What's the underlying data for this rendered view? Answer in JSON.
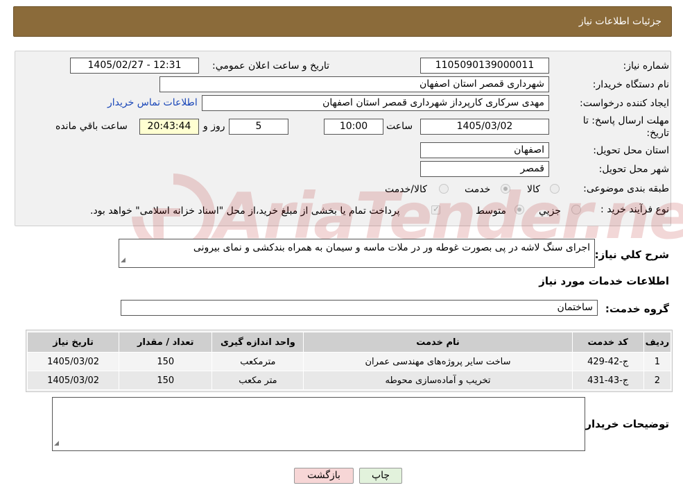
{
  "header": {
    "title": "جزئیات اطلاعات نیاز"
  },
  "form": {
    "need_number": {
      "label": "شماره نیاز:",
      "value": "1105090139000011"
    },
    "announce_datetime": {
      "label": "تاریخ و ساعت اعلان عمومي:",
      "value": "1405/02/27 - 12:31"
    },
    "buyer_org": {
      "label": "نام دستگاه خريدار:",
      "value": "شهرداری قمصر استان اصفهان"
    },
    "requester": {
      "label": "ايجاد کننده درخواست:",
      "value": "مهدی سرکاری کارپرداز شهرداری قمصر استان اصفهان",
      "contact_link": "اطلاعات تماس خريدار"
    },
    "deadline": {
      "label_line1": "مهلت ارسال پاسخ: تا",
      "label_line2": "تاريخ:",
      "date": "1405/03/02",
      "time_label": "ساعت",
      "time": "10:00",
      "days": "5",
      "days_label": "روز و",
      "remaining": "20:43:44",
      "remaining_label": "ساعت باقي مانده"
    },
    "delivery_province": {
      "label": "استان محل تحويل:",
      "value": "اصفهان"
    },
    "delivery_city": {
      "label": "شهر محل تحويل:",
      "value": "قمصر"
    },
    "category": {
      "label": "طبقه بندی موضوعی:",
      "options": [
        "كالا",
        "خدمت",
        "كالا/خدمت"
      ],
      "selected": "خدمت"
    },
    "purchase_type": {
      "label": "نوع فرآيند خريد :",
      "options": [
        "جزيي",
        "متوسط"
      ],
      "selected": "متوسط",
      "payment_note": "پرداخت تمام يا بخشی از مبلغ خريد،از محل \"اسناد خزانه اسلامی\" خواهد بود."
    }
  },
  "description": {
    "label": "شرح كلي نياز:",
    "value": "اجرای سنگ لاشه در پی بصورت غوطه ور در ملات ماسه و سیمان  به همراه بندکشی و نمای بیرونی"
  },
  "services": {
    "section_title": "اطلاعات خدمات مورد نياز",
    "group_label": "گروه خدمت:",
    "group_value": "ساختمان",
    "columns": [
      "رديف",
      "كد خدمت",
      "نام خدمت",
      "واحد اندازه گيری",
      "تعداد / مقدار",
      "تاريخ نياز"
    ],
    "rows": [
      [
        "1",
        "ج-42-429",
        "ساخت ساير پروژه‌های مهندسی عمران",
        "مترمکعب",
        "150",
        "1405/03/02"
      ],
      [
        "2",
        "ج-43-431",
        "تخريب و آماده‌سازی محوطه",
        "متر مكعب",
        "150",
        "1405/03/02"
      ]
    ]
  },
  "buyer_notes": {
    "label": "توضيحات خريدار:",
    "value": ""
  },
  "buttons": {
    "print": "چاپ",
    "back": "بازگشت"
  },
  "watermark": {
    "text": "AriaTender.neT"
  },
  "colors": {
    "header_bg": "#8b6b3a",
    "link": "#1a47b8",
    "back_button": "#f7d6d6",
    "print_button": "#e2f2dc"
  }
}
